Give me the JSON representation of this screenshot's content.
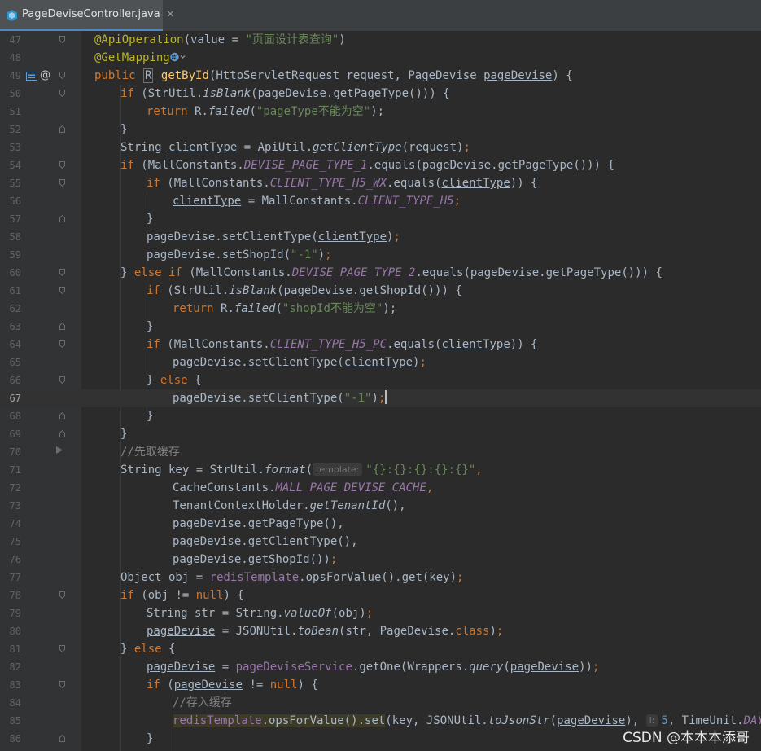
{
  "tab": {
    "file_name": "PageDeviseController.java",
    "close_glyph": "✕"
  },
  "watermark": "CSDN @本本本添哥",
  "lines": [
    {
      "n": "47"
    },
    {
      "n": "48"
    },
    {
      "n": "49"
    },
    {
      "n": "50"
    },
    {
      "n": "51"
    },
    {
      "n": "52"
    },
    {
      "n": "53"
    },
    {
      "n": "54"
    },
    {
      "n": "55"
    },
    {
      "n": "56"
    },
    {
      "n": "57"
    },
    {
      "n": "58"
    },
    {
      "n": "59"
    },
    {
      "n": "60"
    },
    {
      "n": "61"
    },
    {
      "n": "62"
    },
    {
      "n": "63"
    },
    {
      "n": "64"
    },
    {
      "n": "65"
    },
    {
      "n": "66"
    },
    {
      "n": "67"
    },
    {
      "n": "68"
    },
    {
      "n": "69"
    },
    {
      "n": "70"
    },
    {
      "n": "71"
    },
    {
      "n": "72"
    },
    {
      "n": "73"
    },
    {
      "n": "74"
    },
    {
      "n": "75"
    },
    {
      "n": "76"
    },
    {
      "n": "77"
    },
    {
      "n": "78"
    },
    {
      "n": "79"
    },
    {
      "n": "80"
    },
    {
      "n": "81"
    },
    {
      "n": "82"
    },
    {
      "n": "83"
    },
    {
      "n": "84"
    },
    {
      "n": "85"
    },
    {
      "n": "86"
    }
  ],
  "current_line": "67",
  "gutter": {
    "override_marker": "@"
  },
  "code": {
    "l47_ann": "@ApiOperation",
    "l47_a": "(value = ",
    "l47_str": "\"页面设计表查询\"",
    "l47_b": ")",
    "l48_ann": "@GetMapping",
    "l49_kw": "public ",
    "l49_r": "R",
    "l49_fn": "getById",
    "l49_a": "(HttpServletRequest request, PageDevise ",
    "l49_p": "pageDevise",
    "l49_b": ") {",
    "l50_kw": "if ",
    "l50_a": "(StrUtil.",
    "l50_it": "isBlank",
    "l50_b": "(pageDevise.getPageType())) {",
    "l51_kw": "return ",
    "l51_a": "R.",
    "l51_it": "failed",
    "l51_str": "\"pageType不能为空\"",
    "l51_b": ");",
    "l52": "}",
    "l53_a": "String ",
    "l53_u": "clientType",
    "l53_b": " = ApiUtil.",
    "l53_it": "getClientType",
    "l53_c": "(request)",
    "l53_semi": ";",
    "l54_kw": "if ",
    "l54_a": "(MallConstants.",
    "l54_const": "DEVISE_PAGE_TYPE_1",
    "l54_b": ".equals(pageDevise.getPageType())) {",
    "l55_kw": "if ",
    "l55_a": "(MallConstants.",
    "l55_const": "CLIENT_TYPE_H5_WX",
    "l55_b": ".equals(",
    "l55_u": "clientType",
    "l55_c": ")) {",
    "l56_u": "clientType",
    "l56_a": " = MallConstants.",
    "l56_const": "CLIENT_TYPE_H5",
    "l56_semi": ";",
    "l57": "}",
    "l58_a": "pageDevise.setClientType(",
    "l58_u": "clientType",
    "l58_b": ")",
    "l58_semi": ";",
    "l59_a": "pageDevise.setShopId(",
    "l59_str": "\"-1\"",
    "l59_b": ")",
    "l59_semi": ";",
    "l60_a": "} ",
    "l60_kw": "else if ",
    "l60_b": "(MallConstants.",
    "l60_const": "DEVISE_PAGE_TYPE_2",
    "l60_c": ".equals(pageDevise.getPageType())) {",
    "l61_kw": "if ",
    "l61_a": "(StrUtil.",
    "l61_it": "isBlank",
    "l61_b": "(pageDevise.getShopId())) {",
    "l62_kw": "return ",
    "l62_a": "R.",
    "l62_it": "failed",
    "l62_str": "\"shopId不能为空\"",
    "l62_b": ");",
    "l63": "}",
    "l64_kw": "if ",
    "l64_a": "(MallConstants.",
    "l64_const": "CLIENT_TYPE_H5_PC",
    "l64_b": ".equals(",
    "l64_u": "clientType",
    "l64_c": ")) {",
    "l65_a": "pageDevise.setClientType(",
    "l65_u": "clientType",
    "l65_b": ")",
    "l65_semi": ";",
    "l66_a": "} ",
    "l66_kw": "else ",
    "l66_b": "{",
    "l67_a": "pageDevise.setClientType(",
    "l67_str": "\"-1\"",
    "l67_b": ")",
    "l67_semi": ";",
    "l68": "}",
    "l69": "}",
    "l70_cmt": "//先取缓存",
    "l71_a": "String key = StrUtil.",
    "l71_it": "format",
    "l71_hint": "template:",
    "l71_str": "\"{}:{}:{}:{}:{}\"",
    "l71_b": ",",
    "l72_a": "CacheConstants.",
    "l72_const": "MALL_PAGE_DEVISE_CACHE",
    "l72_b": ",",
    "l73_a": "TenantContextHolder.",
    "l73_it": "getTenantId",
    "l73_b": "(),",
    "l74": "pageDevise.getPageType(),",
    "l75": "pageDevise.getClientType(),",
    "l76_a": "pageDevise.getShopId())",
    "l76_semi": ";",
    "l77_a": "Object obj = ",
    "l77_fld": "redisTemplate",
    "l77_b": ".opsForValue().get(key)",
    "l77_semi": ";",
    "l78_kw": "if ",
    "l78_a": "(obj != ",
    "l78_kw2": "null",
    "l78_b": ") {",
    "l79_a": "String str = String.",
    "l79_it": "valueOf",
    "l79_b": "(obj)",
    "l79_semi": ";",
    "l80_u": "pageDevise",
    "l80_a": " = JSONUtil.",
    "l80_it": "toBean",
    "l80_b": "(str, PageDevise.",
    "l80_kw": "class",
    "l80_c": ")",
    "l80_semi": ";",
    "l81_a": "} ",
    "l81_kw": "else ",
    "l81_b": "{",
    "l82_u": "pageDevise",
    "l82_a": " = ",
    "l82_fld": "pageDeviseService",
    "l82_b": ".getOne(Wrappers.",
    "l82_it": "query",
    "l82_c": "(",
    "l82_u2": "pageDevise",
    "l82_d": "))",
    "l82_semi": ";",
    "l83_kw": "if ",
    "l83_a": "(",
    "l83_u": "pageDevise",
    "l83_b": " != ",
    "l83_kw2": "null",
    "l83_c": ") {",
    "l84_cmt": "//存入缓存",
    "l85_fld": "redisTemplate",
    "l85_a": ".opsForValue().set",
    "l85_b": "(key, JSONUtil.",
    "l85_it": "toJsonStr",
    "l85_c": "(",
    "l85_u": "pageDevise",
    "l85_d": "), ",
    "l85_hint": "l:",
    "l85_num": "5",
    "l85_e": ", TimeUnit.",
    "l85_const": "DAYS",
    "l85_f": ");",
    "l86": "}"
  }
}
